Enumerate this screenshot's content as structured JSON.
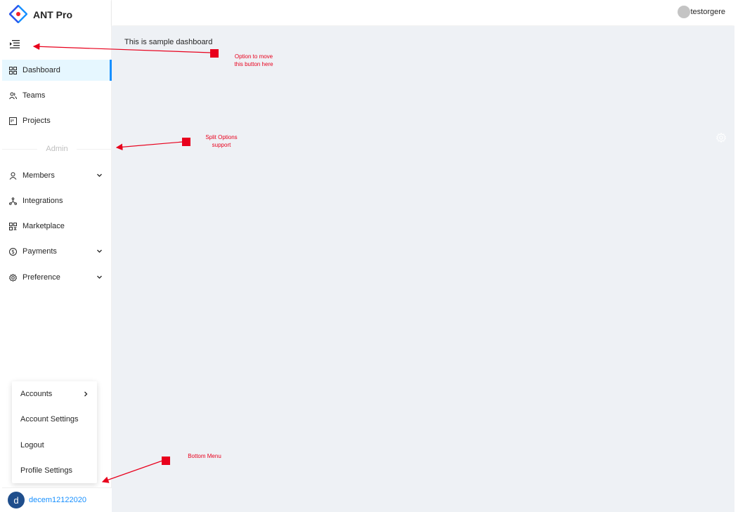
{
  "app": {
    "logo_text": "ANT Pro",
    "accent": "#1890ff"
  },
  "header": {
    "username": "testorgere"
  },
  "sidebar": {
    "items": [
      {
        "label": "Dashboard",
        "icon": "dashboard-icon",
        "active": true
      },
      {
        "label": "Teams",
        "icon": "teams-icon"
      },
      {
        "label": "Projects",
        "icon": "projects-icon"
      }
    ],
    "divider_label": "Admin",
    "admin_items": [
      {
        "label": "Members",
        "icon": "user-icon",
        "submenu": true
      },
      {
        "label": "Integrations",
        "icon": "integrations-icon"
      },
      {
        "label": "Marketplace",
        "icon": "marketplace-icon"
      },
      {
        "label": "Payments",
        "icon": "dollar-icon",
        "submenu": true
      },
      {
        "label": "Preference",
        "icon": "gear-icon",
        "submenu": true
      }
    ]
  },
  "main": {
    "text": "This is sample dashboard"
  },
  "bottom_menu": {
    "items": [
      {
        "label": "Accounts",
        "submenu": true
      },
      {
        "label": "Account Settings"
      },
      {
        "label": "Logout"
      },
      {
        "label": "Profile Settings"
      }
    ]
  },
  "bottom_user": {
    "avatar_letter": "d",
    "name": "decem12122020",
    "avatar_color": "#1f4e8c"
  },
  "annotations": {
    "move_button": "Option to move this button here",
    "move_button_line1": "Option to move",
    "move_button_line2": "this button here",
    "split_line1": "Split Options",
    "split_line2": "support",
    "bottom_menu": "Bottom Menu",
    "color": "#e8001c"
  }
}
